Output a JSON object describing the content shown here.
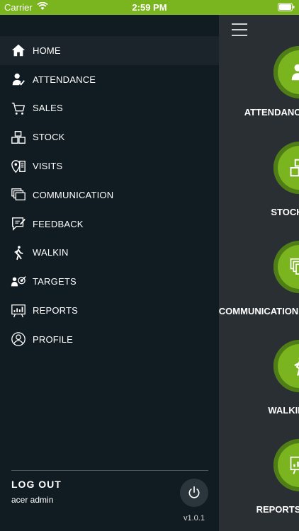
{
  "status_bar": {
    "carrier": "Carrier",
    "time": "2:59 PM"
  },
  "drawer": {
    "items": [
      {
        "label": "HOME",
        "icon": "home-icon",
        "active": true
      },
      {
        "label": "ATTENDANCE",
        "icon": "attendance-icon",
        "active": false
      },
      {
        "label": "SALES",
        "icon": "cart-icon",
        "active": false
      },
      {
        "label": "STOCK",
        "icon": "boxes-icon",
        "active": false
      },
      {
        "label": "VISITS",
        "icon": "map-pin-building-icon",
        "active": false
      },
      {
        "label": "COMMUNICATION",
        "icon": "stacked-windows-icon",
        "active": false
      },
      {
        "label": "FEEDBACK",
        "icon": "chat-edit-icon",
        "active": false
      },
      {
        "label": "WALKIN",
        "icon": "walking-person-icon",
        "active": false
      },
      {
        "label": "TARGETS",
        "icon": "target-people-icon",
        "active": false
      },
      {
        "label": "REPORTS",
        "icon": "chart-board-icon",
        "active": false
      },
      {
        "label": "PROFILE",
        "icon": "user-circle-icon",
        "active": false
      }
    ],
    "footer": {
      "logout_label": "LOG OUT",
      "user_name": "acer admin",
      "version": "v1.0.1"
    }
  },
  "main": {
    "tiles": [
      {
        "label": "ATTENDANCE",
        "icon": "attendance-icon"
      },
      {
        "label": "STOCK",
        "icon": "boxes-icon"
      },
      {
        "label": "COMMUNICATION",
        "icon": "stacked-windows-icon"
      },
      {
        "label": "WALKIN",
        "icon": "walking-person-icon"
      },
      {
        "label": "REPORTS",
        "icon": "chart-board-icon"
      }
    ]
  },
  "colors": {
    "accent": "#7ab41e",
    "drawer_bg": "#111b22",
    "main_bg": "#2a2f33"
  }
}
